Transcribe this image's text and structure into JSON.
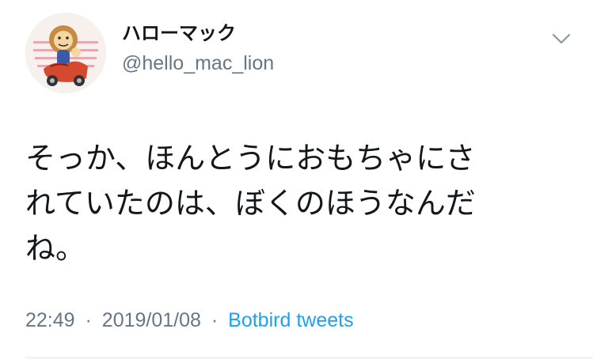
{
  "tweet": {
    "author": {
      "display_name": "ハローマック",
      "handle": "@hello_mac_lion",
      "avatar_icon": "lion-mascot-avatar-icon"
    },
    "menu_icon": "chevron-down-icon",
    "text_lines": [
      "そっか、ほんとうにおもちゃにさ",
      "れていたのは、ぼくのほうなんだ",
      "ね。"
    ],
    "meta": {
      "time": "22:49",
      "separator_1": "·",
      "date": "2019/01/08",
      "separator_2": "·",
      "source": "Botbird tweets"
    }
  },
  "colors": {
    "primary_text": "#14171a",
    "secondary_text": "#657786",
    "link": "#1da1f2",
    "divider": "#e1e8ed",
    "background": "#ffffff"
  }
}
